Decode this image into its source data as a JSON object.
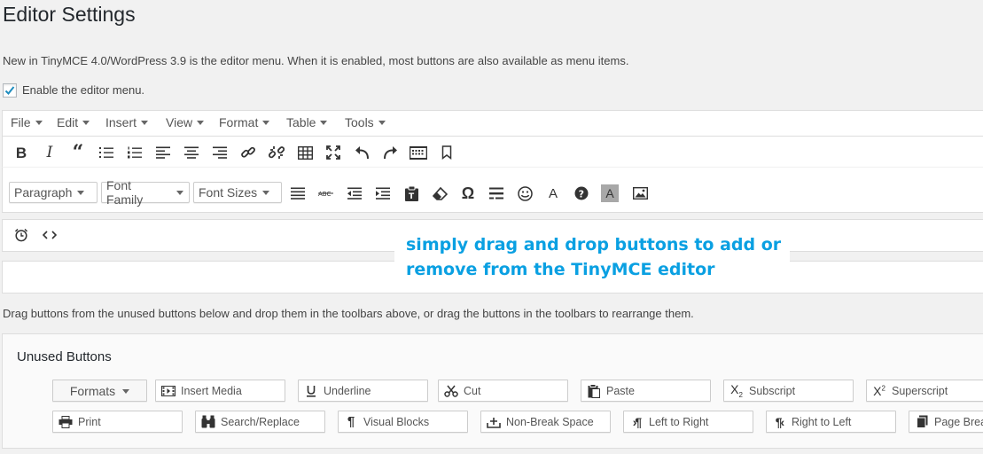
{
  "page": {
    "title": "Editor Settings",
    "description": "New in TinyMCE 4.0/WordPress 3.9 is the editor menu. When it is enabled, most buttons are also available as menu items.",
    "enable_menu_label": "Enable the editor menu.",
    "enable_menu_checked": true,
    "instructions": "Drag buttons from the unused buttons below and drop them in the toolbars above, or drag the buttons in the toolbars to rearrange them."
  },
  "menubar": {
    "items": [
      "File",
      "Edit",
      "Insert",
      "View",
      "Format",
      "Table",
      "Tools"
    ]
  },
  "toolbar1": {
    "icons": [
      "bold-icon",
      "italic-icon",
      "blockquote-icon",
      "bullet-list-icon",
      "numbered-list-icon",
      "align-left-icon",
      "align-center-icon",
      "align-right-icon",
      "link-icon",
      "unlink-icon",
      "table-icon",
      "fullscreen-icon",
      "undo-icon",
      "redo-icon",
      "kitchen-sink-icon",
      "more-tag-icon"
    ]
  },
  "toolbar2": {
    "dropdowns": [
      "Paragraph",
      "Font Family",
      "Font Sizes"
    ],
    "icons": [
      "align-justify-icon",
      "strikethrough-icon",
      "outdent-icon",
      "indent-icon",
      "paste-text-icon",
      "clear-formatting-icon",
      "special-character-icon",
      "horizontal-line-icon",
      "emoticons-icon",
      "text-color-icon",
      "help-icon",
      "background-color-icon",
      "image-icon"
    ]
  },
  "toolbar3": {
    "icons": [
      "clock-icon",
      "code-icon"
    ]
  },
  "callout": {
    "line1": "simply drag and drop buttons to add or",
    "line2": "remove from the TinyMCE editor"
  },
  "unused": {
    "title": "Unused Buttons",
    "formats_label": "Formats",
    "row1": [
      {
        "label": "Insert Media",
        "icon": "film-icon"
      },
      {
        "label": "Underline",
        "icon": "underline-icon"
      },
      {
        "label": "Cut",
        "icon": "scissors-icon"
      },
      {
        "label": "Paste",
        "icon": "clipboard-icon"
      },
      {
        "label": "Subscript",
        "icon": "subscript-icon"
      },
      {
        "label": "Superscript",
        "icon": "superscript-icon"
      }
    ],
    "row2": [
      {
        "label": "Print",
        "icon": "printer-icon"
      },
      {
        "label": "Search/Replace",
        "icon": "binoculars-icon"
      },
      {
        "label": "Visual Blocks",
        "icon": "pilcrow-icon"
      },
      {
        "label": "Non-Break Space",
        "icon": "nbsp-icon"
      },
      {
        "label": "Left to Right",
        "icon": "ltr-icon"
      },
      {
        "label": "Right to Left",
        "icon": "rtl-icon"
      },
      {
        "label": "Page Break",
        "icon": "page-break-icon"
      }
    ]
  }
}
